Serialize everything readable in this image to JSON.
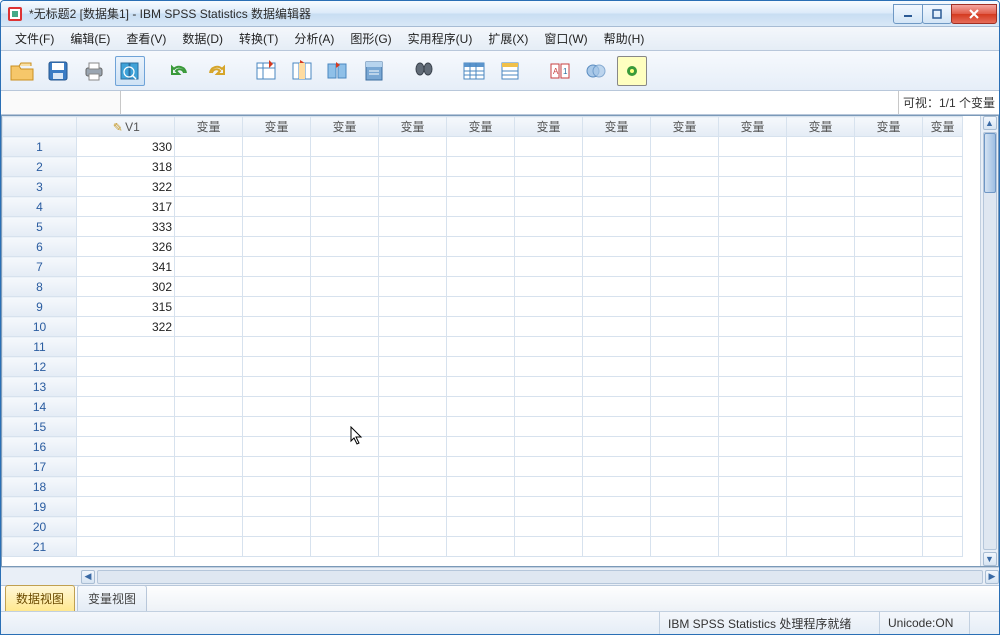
{
  "window": {
    "title": "*无标题2 [数据集1] - IBM SPSS Statistics 数据编辑器"
  },
  "menu": {
    "file": "文件(F)",
    "edit": "编辑(E)",
    "view": "查看(V)",
    "data": "数据(D)",
    "transform": "转换(T)",
    "analyze": "分析(A)",
    "graphs": "图形(G)",
    "utilities": "实用程序(U)",
    "extensions": "扩展(X)",
    "window": "窗口(W)",
    "help": "帮助(H)"
  },
  "toolbar_icons": [
    "open-file-icon",
    "save-icon",
    "print-icon",
    "recall-dialog-icon",
    "undo-icon",
    "redo-icon",
    "goto-case-icon",
    "goto-variable-icon",
    "variables-icon",
    "run-script-icon",
    "find-icon",
    "insert-cases-icon",
    "insert-variable-icon",
    "split-file-icon",
    "weight-cases-icon",
    "select-cases-icon",
    "value-labels-icon"
  ],
  "visibility_label": "可视：1/1 个变量",
  "columns": {
    "first": "V1",
    "placeholder": "变量"
  },
  "rows": [
    {
      "n": "1",
      "v": "330"
    },
    {
      "n": "2",
      "v": "318"
    },
    {
      "n": "3",
      "v": "322"
    },
    {
      "n": "4",
      "v": "317"
    },
    {
      "n": "5",
      "v": "333"
    },
    {
      "n": "6",
      "v": "326"
    },
    {
      "n": "7",
      "v": "341"
    },
    {
      "n": "8",
      "v": "302"
    },
    {
      "n": "9",
      "v": "315"
    },
    {
      "n": "10",
      "v": "322"
    },
    {
      "n": "11",
      "v": ""
    },
    {
      "n": "12",
      "v": ""
    },
    {
      "n": "13",
      "v": ""
    },
    {
      "n": "14",
      "v": ""
    },
    {
      "n": "15",
      "v": ""
    },
    {
      "n": "16",
      "v": ""
    },
    {
      "n": "17",
      "v": ""
    },
    {
      "n": "18",
      "v": ""
    },
    {
      "n": "19",
      "v": ""
    },
    {
      "n": "20",
      "v": ""
    },
    {
      "n": "21",
      "v": ""
    }
  ],
  "tabs": {
    "data_view": "数据视图",
    "variable_view": "变量视图"
  },
  "status": {
    "processor": "IBM SPSS Statistics 处理程序就绪",
    "unicode": "Unicode:ON"
  }
}
